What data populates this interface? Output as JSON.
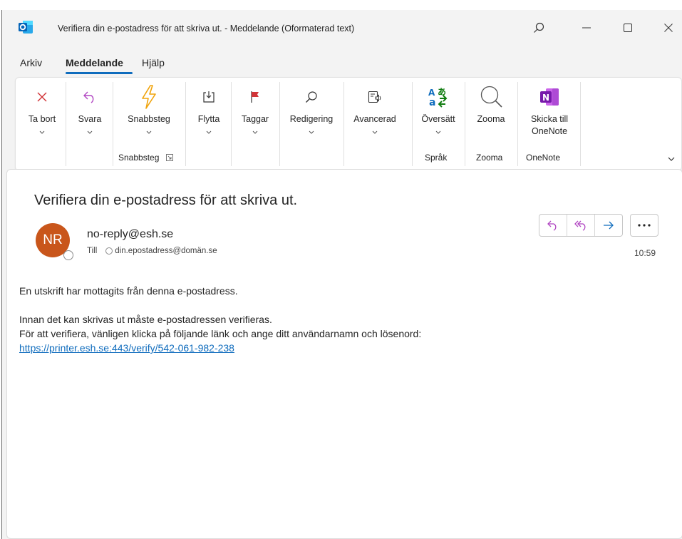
{
  "window": {
    "title": "Verifiera din e-postadress för att skriva ut.  -  Meddelande (Oformaterad text)"
  },
  "menu": {
    "tabs": [
      {
        "label": "Arkiv"
      },
      {
        "label": "Meddelande"
      },
      {
        "label": "Hjälp"
      }
    ]
  },
  "ribbon": {
    "delete": "Ta bort",
    "reply": "Svara",
    "quicksteps": "Snabbsteg",
    "move": "Flytta",
    "tags": "Taggar",
    "editing": "Redigering",
    "advanced": "Avancerad",
    "translate": "Översätt",
    "zoom": "Zooma",
    "onenote_line1": "Skicka till",
    "onenote_line2": "OneNote",
    "groups": {
      "quicksteps": "Snabbsteg",
      "language": "Språk",
      "zoom": "Zooma",
      "onenote": "OneNote"
    }
  },
  "message": {
    "subject": "Verifiera din e-postadress för att skriva ut.",
    "avatar_initials": "NR",
    "sender": "no-reply@esh.se",
    "to_label": "Till",
    "recipient": "din.epostadress@domän.se",
    "time": "10:59",
    "body": {
      "line1": "En utskrift har mottagits från denna e-postadress.",
      "line2": "Innan det kan skrivas ut måste e-postadressen verifieras.",
      "line3": "För att verifiera, vänligen klicka på följande länk och ange ditt användarnamn och lösenord:",
      "link": "https://printer.esh.se:443/verify/542-061-982-238"
    }
  },
  "colors": {
    "accent": "#0f6cbd",
    "avatar": "#c9561b",
    "reply_icon": "#b146c2"
  }
}
